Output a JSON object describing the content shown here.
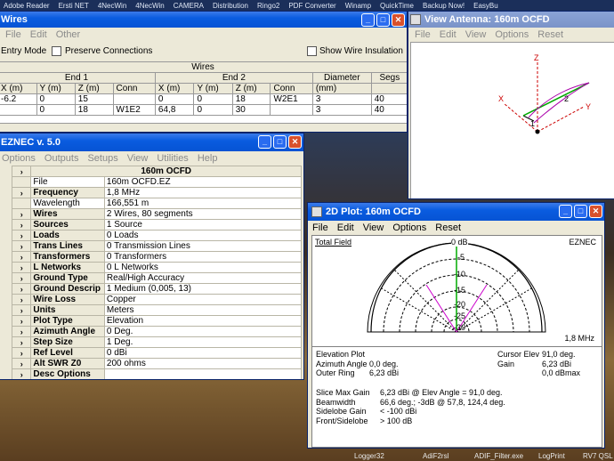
{
  "desktop": {
    "taskbar_top_items": [
      "Adobe Reader",
      "Ersti NET",
      "4NecWin",
      "4NecWin",
      "CAMERA",
      "Distribution",
      "Ringo2",
      "PDF Converter",
      "Winamp",
      "QuickTime",
      "Backup Now!",
      "EasyBu"
    ],
    "taskbar_bottom_items": [
      "Logger32",
      "AdiF2rsl",
      "ADIF_Filter.exe",
      "LogPrint",
      "RV7 QSL"
    ]
  },
  "wires_window": {
    "title": "Wires",
    "menu": [
      "File",
      "Edit",
      "Other"
    ],
    "entry_mode_label": "Entry Mode",
    "preserve_connections_label": "Preserve Connections",
    "show_wire_insulation_label": "Show Wire Insulation",
    "table_title": "Wires",
    "group_end1": "End 1",
    "group_end2": "End 2",
    "group_diameter": "Diameter",
    "group_segs": "Segs",
    "columns": [
      "X (m)",
      "Y (m)",
      "Z (m)",
      "Conn",
      "X (m)",
      "Y (m)",
      "Z (m)",
      "Conn",
      "(mm)",
      ""
    ],
    "rows": [
      [
        "-6.2",
        "0",
        "15",
        "",
        "0",
        "0",
        "18",
        "W2E1",
        "3",
        "40"
      ],
      [
        "",
        "0",
        "18",
        "W1E2",
        "64,8",
        "0",
        "30",
        "",
        "3",
        "40"
      ]
    ]
  },
  "antenna_window": {
    "title": "View Antenna: 160m OCFD",
    "menu": [
      "File",
      "Edit",
      "View",
      "Options",
      "Reset"
    ],
    "axis_z": "Z",
    "axis_y": "Y",
    "axis_x": "X",
    "wire_label_1": "1",
    "wire_label_2": "2"
  },
  "main_window": {
    "title": "EZNEC v. 5.0",
    "menu": [
      "Options",
      "Outputs",
      "Setups",
      "View",
      "Utilities",
      "Help"
    ],
    "header_value": "160m OCFD",
    "rows": [
      {
        "label": "File",
        "value": "160m OCFD.EZ",
        "bold": false,
        "button": false
      },
      {
        "label": "Frequency",
        "value": "1,8 MHz",
        "bold": true,
        "button": true
      },
      {
        "label": "Wavelength",
        "value": "166,551 m",
        "bold": false,
        "button": false
      },
      {
        "label": "Wires",
        "value": "2 Wires, 80 segments",
        "bold": true,
        "button": true
      },
      {
        "label": "Sources",
        "value": "1 Source",
        "bold": true,
        "button": true
      },
      {
        "label": "Loads",
        "value": "0 Loads",
        "bold": true,
        "button": true
      },
      {
        "label": "Trans Lines",
        "value": "0 Transmission Lines",
        "bold": true,
        "button": true
      },
      {
        "label": "Transformers",
        "value": "0 Transformers",
        "bold": true,
        "button": true
      },
      {
        "label": "L Networks",
        "value": "0 L Networks",
        "bold": true,
        "button": true
      },
      {
        "label": "Ground Type",
        "value": "Real/High Accuracy",
        "bold": true,
        "button": true
      },
      {
        "label": "Ground Descrip",
        "value": "1 Medium (0,005, 13)",
        "bold": true,
        "button": true
      },
      {
        "label": "Wire Loss",
        "value": "Copper",
        "bold": true,
        "button": true
      },
      {
        "label": "Units",
        "value": "Meters",
        "bold": true,
        "button": true
      },
      {
        "label": "Plot Type",
        "value": "Elevation",
        "bold": true,
        "button": true
      },
      {
        "label": "Azimuth Angle",
        "value": "0 Deg.",
        "bold": true,
        "button": true
      },
      {
        "label": "Step Size",
        "value": "1 Deg.",
        "bold": true,
        "button": true
      },
      {
        "label": "Ref Level",
        "value": "0 dBi",
        "bold": true,
        "button": true
      },
      {
        "label": "Alt SWR Z0",
        "value": "200 ohms",
        "bold": true,
        "button": true
      },
      {
        "label": "Desc Options",
        "value": "",
        "bold": true,
        "button": true
      }
    ]
  },
  "plot_window": {
    "title": "2D Plot: 160m OCFD",
    "menu": [
      "File",
      "Edit",
      "View",
      "Options",
      "Reset"
    ],
    "total_field_label": "Total Field",
    "brand_label": "EZNEC",
    "freq_label": "1,8 MHz",
    "ring_labels": [
      "0 dB",
      "-5",
      "-10",
      "-15",
      "-20",
      "-25",
      "-30"
    ],
    "info_left": [
      [
        "Elevation Plot",
        ""
      ],
      [
        "Azimuth Angle",
        "0,0 deg."
      ],
      [
        "Outer Ring",
        "6,23 dBi"
      ]
    ],
    "info_right": [
      [
        "Cursor Elev",
        "91,0 deg."
      ],
      [
        "Gain",
        "6,23 dBi"
      ],
      [
        "",
        "0,0 dBmax"
      ]
    ],
    "info_bottom": [
      [
        "Slice Max Gain",
        "6,23 dBi @ Elev Angle = 91,0 deg."
      ],
      [
        "Beamwidth",
        "66,6 deg.; -3dB @ 57,8, 124,4 deg."
      ],
      [
        "Sidelobe Gain",
        "< -100 dBi"
      ],
      [
        "Front/Sidelobe",
        "> 100 dB"
      ]
    ]
  }
}
